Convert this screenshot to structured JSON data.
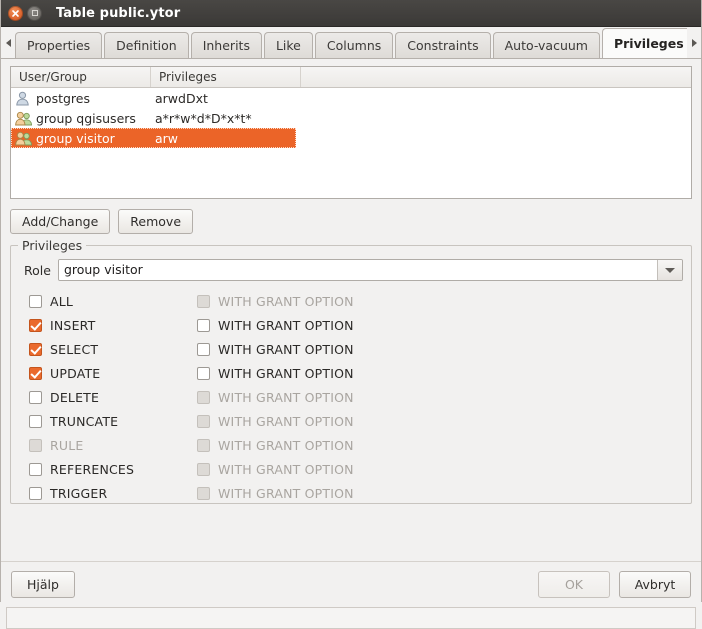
{
  "window": {
    "title": "Table public.ytor",
    "close_icon": "close-icon",
    "maximize_icon": "maximize-icon"
  },
  "tabbar": {
    "scroll_left_icon": "chevron-left-icon",
    "scroll_right_icon": "chevron-right-icon",
    "tabs": [
      {
        "label": "Properties",
        "active": false
      },
      {
        "label": "Definition",
        "active": false
      },
      {
        "label": "Inherits",
        "active": false
      },
      {
        "label": "Like",
        "active": false
      },
      {
        "label": "Columns",
        "active": false
      },
      {
        "label": "Constraints",
        "active": false
      },
      {
        "label": "Auto-vacuum",
        "active": false
      },
      {
        "label": "Privileges",
        "active": true
      }
    ]
  },
  "acl_table": {
    "columns": [
      "User/Group",
      "Privileges",
      ""
    ],
    "rows": [
      {
        "icon": "user-icon",
        "name": "postgres",
        "privileges": "arwdDxt",
        "selected": false
      },
      {
        "icon": "group-icon",
        "name": "group qgisusers",
        "privileges": "a*r*w*d*D*x*t*",
        "selected": false
      },
      {
        "icon": "group-icon",
        "name": "group visitor",
        "privileges": "arw",
        "selected": true
      }
    ]
  },
  "actions": {
    "add_change_label": "Add/Change",
    "remove_label": "Remove"
  },
  "privileges_group": {
    "legend": "Privileges",
    "role_label": "Role",
    "role_value": "group visitor",
    "role_dropdown_icon": "chevron-down-icon",
    "grant_option_label": "WITH GRANT OPTION",
    "items": [
      {
        "name": "ALL",
        "checked": false,
        "disabled": false,
        "grant_checked": false,
        "grant_disabled": true
      },
      {
        "name": "INSERT",
        "checked": true,
        "disabled": false,
        "grant_checked": false,
        "grant_disabled": false
      },
      {
        "name": "SELECT",
        "checked": true,
        "disabled": false,
        "grant_checked": false,
        "grant_disabled": false
      },
      {
        "name": "UPDATE",
        "checked": true,
        "disabled": false,
        "grant_checked": false,
        "grant_disabled": false
      },
      {
        "name": "DELETE",
        "checked": false,
        "disabled": false,
        "grant_checked": false,
        "grant_disabled": true
      },
      {
        "name": "TRUNCATE",
        "checked": false,
        "disabled": false,
        "grant_checked": false,
        "grant_disabled": true
      },
      {
        "name": "RULE",
        "checked": false,
        "disabled": true,
        "grant_checked": false,
        "grant_disabled": true
      },
      {
        "name": "REFERENCES",
        "checked": false,
        "disabled": false,
        "grant_checked": false,
        "grant_disabled": true
      },
      {
        "name": "TRIGGER",
        "checked": false,
        "disabled": false,
        "grant_checked": false,
        "grant_disabled": true
      }
    ]
  },
  "footer": {
    "help_label": "Hjälp",
    "ok_label": "OK",
    "ok_disabled": true,
    "cancel_label": "Avbryt"
  },
  "statusbar": {
    "text": ""
  },
  "colors": {
    "accent": "#eb6428",
    "titlebar": "#3b3937",
    "background": "#f2f1f0"
  }
}
